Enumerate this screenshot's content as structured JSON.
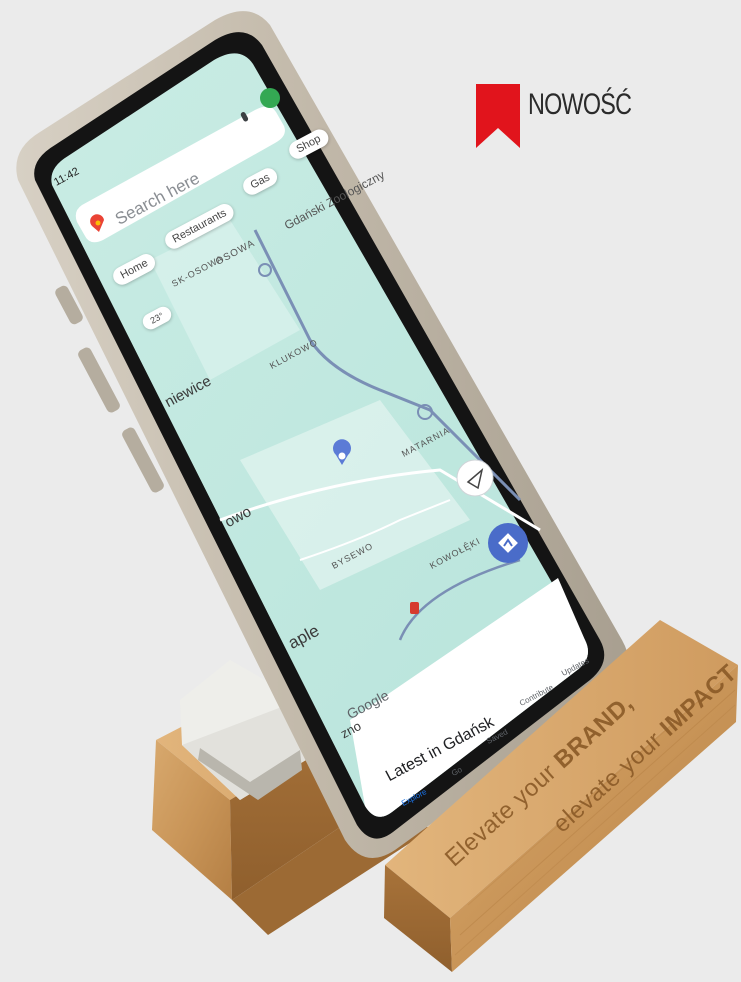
{
  "badge": {
    "label": "NOWOŚĆ",
    "color": "#e1141c"
  },
  "phone": {
    "status_time": "11:42",
    "search_placeholder": "Search here",
    "chips": [
      "Home",
      "Restaurants",
      "Gas",
      "Shop"
    ],
    "weather": "23°",
    "map_labels": [
      "SK-OSOWA",
      "OSOWA",
      "KLUKOWO",
      "MATARNIA",
      "BYSEWO",
      "KOWOŁĘ̂KI",
      "Gdański Zoologiczny"
    ],
    "city_labels": [
      "niewice",
      "owo",
      "aple",
      "zno"
    ],
    "google_logo": "Google",
    "bottom_sheet_title": "Latest in Gdańsk",
    "nav": [
      "Explore",
      "Go",
      "Saved",
      "Contribute",
      "Updates"
    ]
  },
  "stand": {
    "engraving_line1_prefix": "Elevate your ",
    "engraving_line1_bold": "BRAND,",
    "engraving_line2_prefix": "elevate your ",
    "engraving_line2_bold": "IMPACT",
    "wood_color": "#c9955b"
  }
}
